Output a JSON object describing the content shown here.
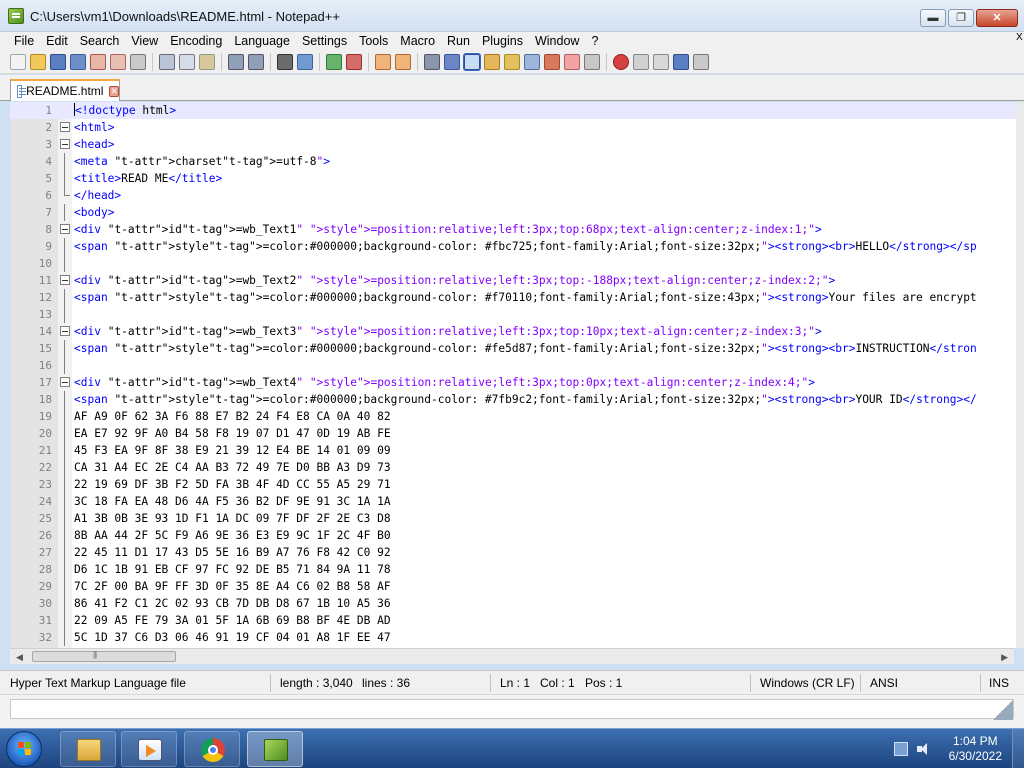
{
  "window": {
    "title": "C:\\Users\\vm1\\Downloads\\README.html - Notepad++"
  },
  "window_controls": {
    "minimize": "▬",
    "maximize": "❐",
    "close": "✕"
  },
  "menu": [
    "File",
    "Edit",
    "Search",
    "View",
    "Encoding",
    "Language",
    "Settings",
    "Tools",
    "Macro",
    "Run",
    "Plugins",
    "Window",
    "?"
  ],
  "menu_overflow": "X",
  "tab": {
    "label": "README.html",
    "close": "✕"
  },
  "editor_lines": [
    {
      "n": "1",
      "t": "<!doctype html>"
    },
    {
      "n": "2",
      "t": "<html>"
    },
    {
      "n": "3",
      "t": "<head>"
    },
    {
      "n": "4",
      "t": "<meta charset=\"utf-8\">"
    },
    {
      "n": "5",
      "t": "<title>READ ME</title>"
    },
    {
      "n": "6",
      "t": "</head>"
    },
    {
      "n": "7",
      "t": "<body>"
    },
    {
      "n": "8",
      "t": "<div id=\"wb_Text1\" style=\"position:relative;left:3px;top:68px;text-align:center;z-index:1;\">"
    },
    {
      "n": "9",
      "t": "<span style=\"color:#000000;background-color: #fbc725;font-family:Arial;font-size:32px;\"><strong><br>HELLO</strong></sp"
    },
    {
      "n": "10",
      "t": ""
    },
    {
      "n": "11",
      "t": "<div id=\"wb_Text2\" style=\"position:relative;left:3px;top:-188px;text-align:center;z-index:2;\">"
    },
    {
      "n": "12",
      "t": "<span style=\"color:#000000;background-color: #f70110;font-family:Arial;font-size:43px;\"><strong>Your files are encrypt"
    },
    {
      "n": "13",
      "t": ""
    },
    {
      "n": "14",
      "t": "<div id=\"wb_Text3\" style=\"position:relative;left:3px;top:10px;text-align:center;z-index:3;\">"
    },
    {
      "n": "15",
      "t": "<span style=\"color:#000000;background-color: #fe5d87;font-family:Arial;font-size:32px;\"><strong><br>INSTRUCTION</stron"
    },
    {
      "n": "16",
      "t": ""
    },
    {
      "n": "17",
      "t": "<div id=\"wb_Text4\" style=\"position:relative;left:3px;top:0px;text-align:center;z-index:4;\">"
    },
    {
      "n": "18",
      "t": "<span style=\"color:#000000;background-color: #7fb9c2;font-family:Arial;font-size:32px;\"><strong><br>YOUR ID</strong></"
    },
    {
      "n": "19",
      "t": "AF A9 0F 62 3A F6 88 E7 B2 24 F4 E8 CA 0A 40 82"
    },
    {
      "n": "20",
      "t": "EA E7 92 9F A0 B4 58 F8 19 07 D1 47 0D 19 AB FE"
    },
    {
      "n": "21",
      "t": "45 F3 EA 9F 8F 38 E9 21 39 12 E4 BE 14 01 09 09"
    },
    {
      "n": "22",
      "t": "CA 31 A4 EC 2E C4 AA B3 72 49 7E D0 BB A3 D9 73"
    },
    {
      "n": "23",
      "t": "22 19 69 DF 3B F2 5D FA 3B 4F 4D CC 55 A5 29 71"
    },
    {
      "n": "24",
      "t": "3C 18 FA EA 48 D6 4A F5 36 B2 DF 9E 91 3C 1A 1A"
    },
    {
      "n": "25",
      "t": "A1 3B 0B 3E 93 1D F1 1A DC 09 7F DF 2F 2E C3 D8"
    },
    {
      "n": "26",
      "t": "8B AA 44 2F 5C F9 A6 9E 36 E3 E9 9C 1F 2C 4F B0"
    },
    {
      "n": "27",
      "t": "22 45 11 D1 17 43 D5 5E 16 B9 A7 76 F8 42 C0 92"
    },
    {
      "n": "28",
      "t": "D6 1C 1B 91 EB CF 97 FC 92 DE B5 71 84 9A 11 78"
    },
    {
      "n": "29",
      "t": "7C 2F 00 BA 9F FF 3D 0F 35 8E A4 C6 02 B8 58 AF"
    },
    {
      "n": "30",
      "t": "86 41 F2 C1 2C 02 93 CB 7D DB D8 67 1B 10 A5 36"
    },
    {
      "n": "31",
      "t": "22 09 A5 FE 79 3A 01 5F 1A 6B 69 B8 BF 4E DB AD"
    },
    {
      "n": "32",
      "t": "5C 1D 37 C6 D3 06 46 91 19 CF 04 01 A8 1F EE 47"
    }
  ],
  "status": {
    "file_type": "Hyper Text Markup Language file",
    "length": "length : 3,040",
    "lines": "lines : 36",
    "ln": "Ln : 1",
    "col": "Col : 1",
    "pos": "Pos : 1",
    "eol": "Windows (CR LF)",
    "encoding": "ANSI",
    "mode": "INS"
  },
  "taskbar": {
    "time": "1:04 PM",
    "date": "6/30/2022"
  }
}
